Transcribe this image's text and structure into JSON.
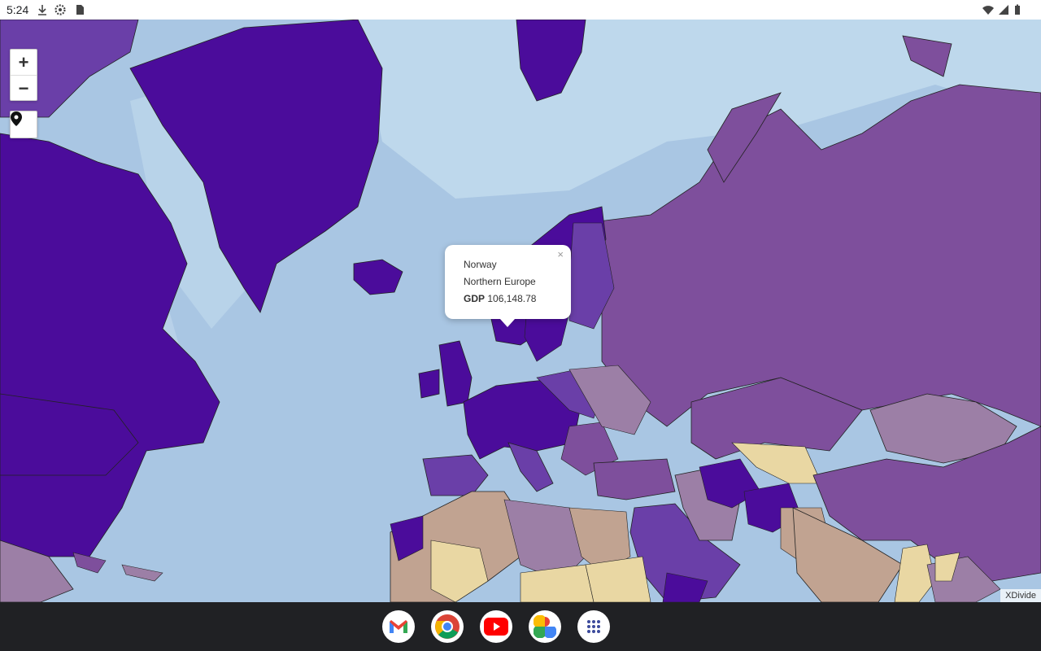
{
  "status_bar": {
    "time": "5:24",
    "left_icons": [
      "download-icon",
      "settings-icon",
      "sd-card-icon"
    ],
    "right_icons": [
      "wifi-icon",
      "signal-icon",
      "battery-icon"
    ]
  },
  "map": {
    "controls": {
      "zoom_in": "+",
      "zoom_out": "−",
      "locate_icon": "location-pin-icon"
    },
    "popup": {
      "country": "Norway",
      "region": "Northern Europe",
      "metric_label": "GDP",
      "metric_value": "106,148.78",
      "close": "×"
    },
    "attribution": "XDivide",
    "colors": {
      "ocean": "#a9c6e3",
      "ice": "#c8dff0",
      "highest": "#4b0c9b",
      "high": "#6a3fa8",
      "mid": "#7e4f9c",
      "midlow": "#9c7fa6",
      "low": "#c1a391",
      "lowest": "#e9d7a3"
    }
  },
  "taskbar": {
    "apps": [
      {
        "name": "gmail-icon"
      },
      {
        "name": "chrome-icon"
      },
      {
        "name": "youtube-icon"
      },
      {
        "name": "photos-icon"
      },
      {
        "name": "app-drawer-icon"
      }
    ]
  }
}
